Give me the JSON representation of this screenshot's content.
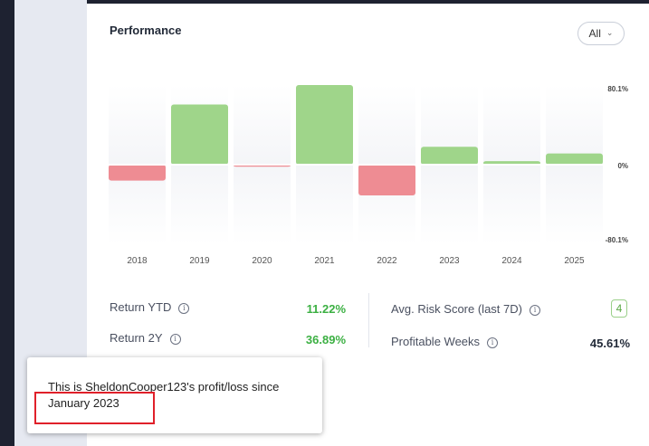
{
  "card": {
    "title": "Performance",
    "filter": {
      "label": "All",
      "icon": "chevron-down-icon"
    }
  },
  "chart_data": {
    "type": "bar",
    "categories": [
      "2018",
      "2019",
      "2020",
      "2021",
      "2022",
      "2023",
      "2024",
      "2025"
    ],
    "values": [
      -16,
      60.5,
      -2,
      80.1,
      -31,
      18,
      3.5,
      11.22
    ],
    "y_tick_labels": [
      "80.1%",
      "0%",
      "-80.1%"
    ],
    "ylim": [
      -80.1,
      80.1
    ],
    "colors": {
      "positive": "#9fd58a",
      "negative": "#ee8c93",
      "track": "#f4f5f8"
    }
  },
  "metrics": {
    "return_ytd": {
      "label": "Return YTD",
      "value": "11.22%"
    },
    "return_2y": {
      "label": "Return 2Y",
      "value": "36.89%"
    },
    "risk": {
      "label": "Avg. Risk Score (last 7D)",
      "value": "4"
    },
    "profitable_weeks": {
      "label": "Profitable Weeks",
      "value": "45.61%"
    }
  },
  "tooltip": {
    "text": "This is SheldonCooper123's profit/loss since January 2023"
  },
  "colors": {
    "accent_green": "#3cb043",
    "highlight_red": "#e0202a"
  }
}
